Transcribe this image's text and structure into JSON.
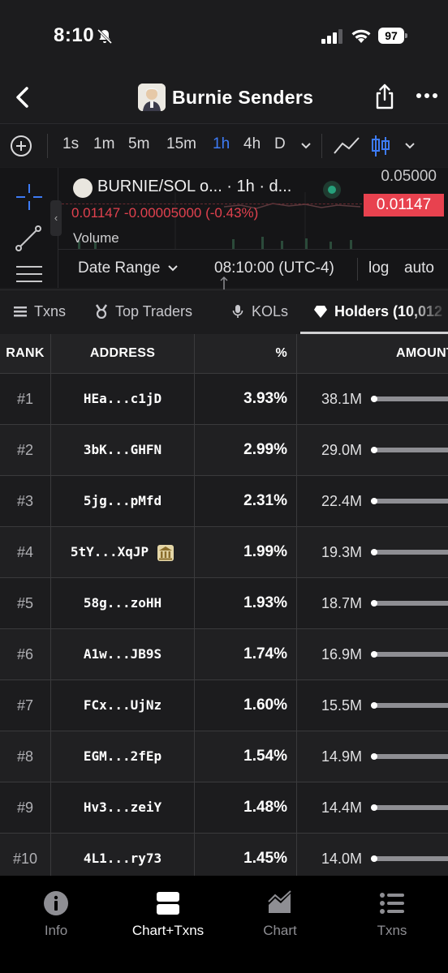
{
  "status_bar": {
    "time": "8:10",
    "battery": "97"
  },
  "header": {
    "title": "Burnie Senders"
  },
  "timeframes": {
    "items": [
      "1s",
      "1m",
      "5m",
      "15m",
      "1h",
      "4h",
      "D"
    ],
    "active": "1h"
  },
  "chart": {
    "pair_label": "BURNIE/SOL o... · 1h · d...",
    "price_axis_top": "0.05000",
    "current_price": "0.01147",
    "change_text": "0.01147  -0.00005000 (-0.43%)",
    "volume_label": "Volume",
    "date_range_label": "Date Range",
    "timezone_label": "08:10:00 (UTC-4)",
    "log_label": "log",
    "auto_label": "auto"
  },
  "tabs": [
    {
      "label": "Txns",
      "icon": "list-icon"
    },
    {
      "label": "Top Traders",
      "icon": "medal-icon"
    },
    {
      "label": "KOLs",
      "icon": "microphone-icon"
    },
    {
      "label": "Holders (10,012",
      "icon": "diamond-icon",
      "active": true
    }
  ],
  "table": {
    "headers": {
      "rank": "RANK",
      "address": "ADDRESS",
      "percent": "%",
      "amount": "AMOUNT"
    },
    "rows": [
      {
        "rank": "#1",
        "address": "HEa...c1jD",
        "percent": "3.93%",
        "amount": "38.1M"
      },
      {
        "rank": "#2",
        "address": "3bK...GHFN",
        "percent": "2.99%",
        "amount": "29.0M"
      },
      {
        "rank": "#3",
        "address": "5jg...pMfd",
        "percent": "2.31%",
        "amount": "22.4M"
      },
      {
        "rank": "#4",
        "address": "5tY...XqJP",
        "percent": "1.99%",
        "amount": "19.3M",
        "bank_icon": true
      },
      {
        "rank": "#5",
        "address": "58g...zoHH",
        "percent": "1.93%",
        "amount": "18.7M"
      },
      {
        "rank": "#6",
        "address": "A1w...JB9S",
        "percent": "1.74%",
        "amount": "16.9M"
      },
      {
        "rank": "#7",
        "address": "FCx...UjNz",
        "percent": "1.60%",
        "amount": "15.5M"
      },
      {
        "rank": "#8",
        "address": "EGM...2fEp",
        "percent": "1.54%",
        "amount": "14.9M"
      },
      {
        "rank": "#9",
        "address": "Hv3...zeiY",
        "percent": "1.48%",
        "amount": "14.4M"
      },
      {
        "rank": "#10",
        "address": "4L1...ry73",
        "percent": "1.45%",
        "amount": "14.0M"
      }
    ]
  },
  "bottom_nav": [
    {
      "label": "Info",
      "icon": "info-icon"
    },
    {
      "label": "Chart+Txns",
      "icon": "split-view-icon",
      "active": true
    },
    {
      "label": "Chart",
      "icon": "area-chart-icon"
    },
    {
      "label": "Txns",
      "icon": "list-icon"
    }
  ],
  "colors": {
    "accent_blue": "#3d7bf5",
    "price_red": "#e8424f",
    "live_green": "#26a17b"
  }
}
